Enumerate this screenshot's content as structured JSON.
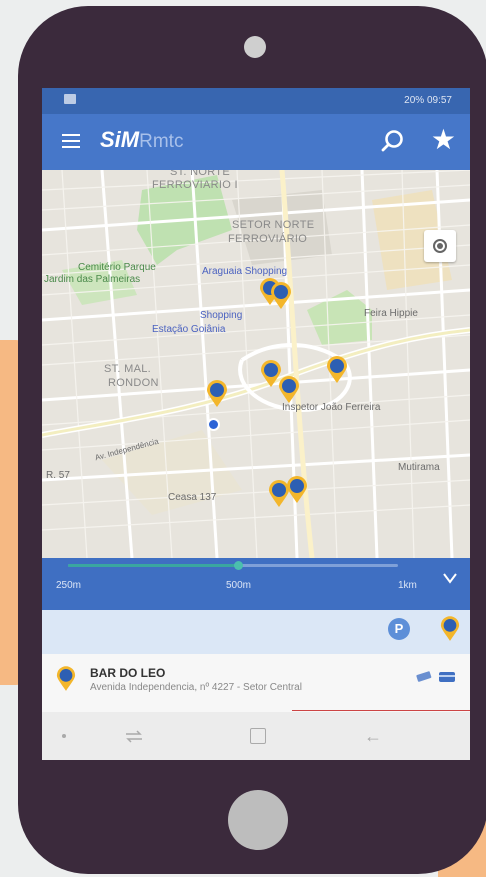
{
  "status_bar": {
    "right_text": "20% 09:57"
  },
  "app_bar": {
    "logo_bold": "SiM",
    "logo_light": "Rmtc",
    "menu_icon": "hamburger-icon",
    "search_icon": "search-icon",
    "favorite_icon": "star-icon"
  },
  "map": {
    "labels": [
      {
        "text": "ST. NORTE"
      },
      {
        "text": "FERROVIARIO I"
      },
      {
        "text": "SETOR NORTE"
      },
      {
        "text": "FERROVIÁRIO"
      },
      {
        "text": "Cemitério Parque"
      },
      {
        "text": "Jardim das Palmeiras"
      },
      {
        "text": "Araguaia Shopping"
      },
      {
        "text": "Shopping"
      },
      {
        "text": "Estação Goiânia"
      },
      {
        "text": "Feira Hippie"
      },
      {
        "text": "ST. MAL."
      },
      {
        "text": "RONDON"
      },
      {
        "text": "Inspetor João Ferreira"
      },
      {
        "text": "Mutirama"
      },
      {
        "text": "Ceasa 137"
      },
      {
        "text": "Av. Independência"
      },
      {
        "text": "R. 57"
      }
    ],
    "pins": [
      {
        "name": "station-pin-1",
        "count": 2
      },
      {
        "name": "station-pin-2",
        "count": 1
      },
      {
        "name": "station-pin-3",
        "count": 2
      },
      {
        "name": "station-pin-4",
        "count": 1
      },
      {
        "name": "station-pin-5",
        "count": 2
      }
    ],
    "my_location_icon": "my-location-icon"
  },
  "range": {
    "labels": [
      "250m",
      "500m",
      "1km"
    ],
    "selected_fraction": 0.52,
    "collapse_icon": "chevron-down-icon"
  },
  "filters": {
    "parking_label": "P",
    "station_icon": "bus-station-icon"
  },
  "result": {
    "title": "BAR DO LEO",
    "address": "Avenida Independencia, nº 4227 - Setor Central",
    "icons": [
      "ticket-icon",
      "card-icon"
    ]
  },
  "nav_bar": {
    "icons": [
      "dot-icon",
      "recent-apps-icon",
      "home-icon",
      "back-icon"
    ]
  },
  "colors": {
    "primary": "#4677c9",
    "status": "#3866b0",
    "pin": "#f3b62b",
    "phone": "#3b2a3c",
    "background_shape": "#f6b983"
  }
}
